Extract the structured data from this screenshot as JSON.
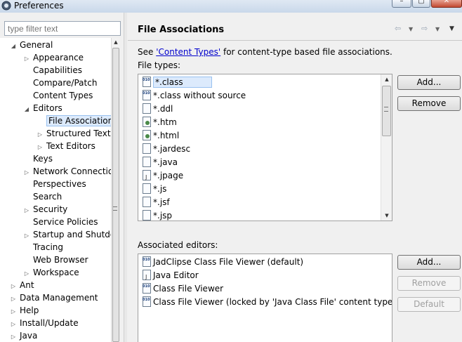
{
  "window": {
    "title": "Preferences"
  },
  "filter": {
    "placeholder": "type filter text"
  },
  "tree": {
    "items": [
      {
        "label": "General",
        "arrow": "◢",
        "indent": 0
      },
      {
        "label": "Appearance",
        "arrow": "▷",
        "indent": 1
      },
      {
        "label": "Capabilities",
        "arrow": "",
        "indent": 1
      },
      {
        "label": "Compare/Patch",
        "arrow": "",
        "indent": 1
      },
      {
        "label": "Content Types",
        "arrow": "",
        "indent": 1
      },
      {
        "label": "Editors",
        "arrow": "◢",
        "indent": 1
      },
      {
        "label": "File Associations",
        "arrow": "",
        "indent": 2,
        "selected": true
      },
      {
        "label": "Structured Text E",
        "arrow": "▷",
        "indent": 2
      },
      {
        "label": "Text Editors",
        "arrow": "▷",
        "indent": 2
      },
      {
        "label": "Keys",
        "arrow": "",
        "indent": 1
      },
      {
        "label": "Network Connection",
        "arrow": "▷",
        "indent": 1
      },
      {
        "label": "Perspectives",
        "arrow": "",
        "indent": 1
      },
      {
        "label": "Search",
        "arrow": "",
        "indent": 1
      },
      {
        "label": "Security",
        "arrow": "▷",
        "indent": 1
      },
      {
        "label": "Service Policies",
        "arrow": "",
        "indent": 1
      },
      {
        "label": "Startup and Shutdov",
        "arrow": "▷",
        "indent": 1
      },
      {
        "label": "Tracing",
        "arrow": "",
        "indent": 1
      },
      {
        "label": "Web Browser",
        "arrow": "",
        "indent": 1
      },
      {
        "label": "Workspace",
        "arrow": "▷",
        "indent": 1
      },
      {
        "label": "Ant",
        "arrow": "▷",
        "indent": 0
      },
      {
        "label": "Data Management",
        "arrow": "▷",
        "indent": 0
      },
      {
        "label": "Help",
        "arrow": "▷",
        "indent": 0
      },
      {
        "label": "Install/Update",
        "arrow": "▷",
        "indent": 0
      },
      {
        "label": "Java",
        "arrow": "▷",
        "indent": 0
      }
    ]
  },
  "page": {
    "title": "File Associations",
    "see_prefix": "See ",
    "see_link": "'Content Types'",
    "see_suffix": " for content-type based file associations.",
    "file_types_label": "File types:",
    "associated_editors_label": "Associated editors:"
  },
  "file_types": [
    {
      "label": "*.class",
      "icon": "class-file-icon",
      "selected": true
    },
    {
      "label": "*.class without source",
      "icon": "class-file-icon"
    },
    {
      "label": "*.ddl",
      "icon": "ddl-file-icon"
    },
    {
      "label": "*.htm",
      "icon": "web-file-icon"
    },
    {
      "label": "*.html",
      "icon": "web-file-icon"
    },
    {
      "label": "*.jardesc",
      "icon": "jardesc-file-icon"
    },
    {
      "label": "*.java",
      "icon": "text-file-icon"
    },
    {
      "label": "*.jpage",
      "icon": "jpage-file-icon"
    },
    {
      "label": "*.js",
      "icon": "js-file-icon"
    },
    {
      "label": "*.jsf",
      "icon": "text-file-icon"
    },
    {
      "label": "*.jsp",
      "icon": "text-file-icon"
    }
  ],
  "editors": [
    {
      "label": "JadClipse Class File Viewer (default)",
      "icon": "class-file-icon"
    },
    {
      "label": "Java Editor",
      "icon": "java-editor-icon"
    },
    {
      "label": "Class File Viewer",
      "icon": "class-file-icon"
    },
    {
      "label": "Class File Viewer (locked by 'Java Class File' content type)",
      "icon": "class-file-icon"
    }
  ],
  "buttons": {
    "file_add": "Add...",
    "file_remove": "Remove",
    "editor_add": "Add...",
    "editor_remove": "Remove",
    "editor_default": "Default"
  }
}
